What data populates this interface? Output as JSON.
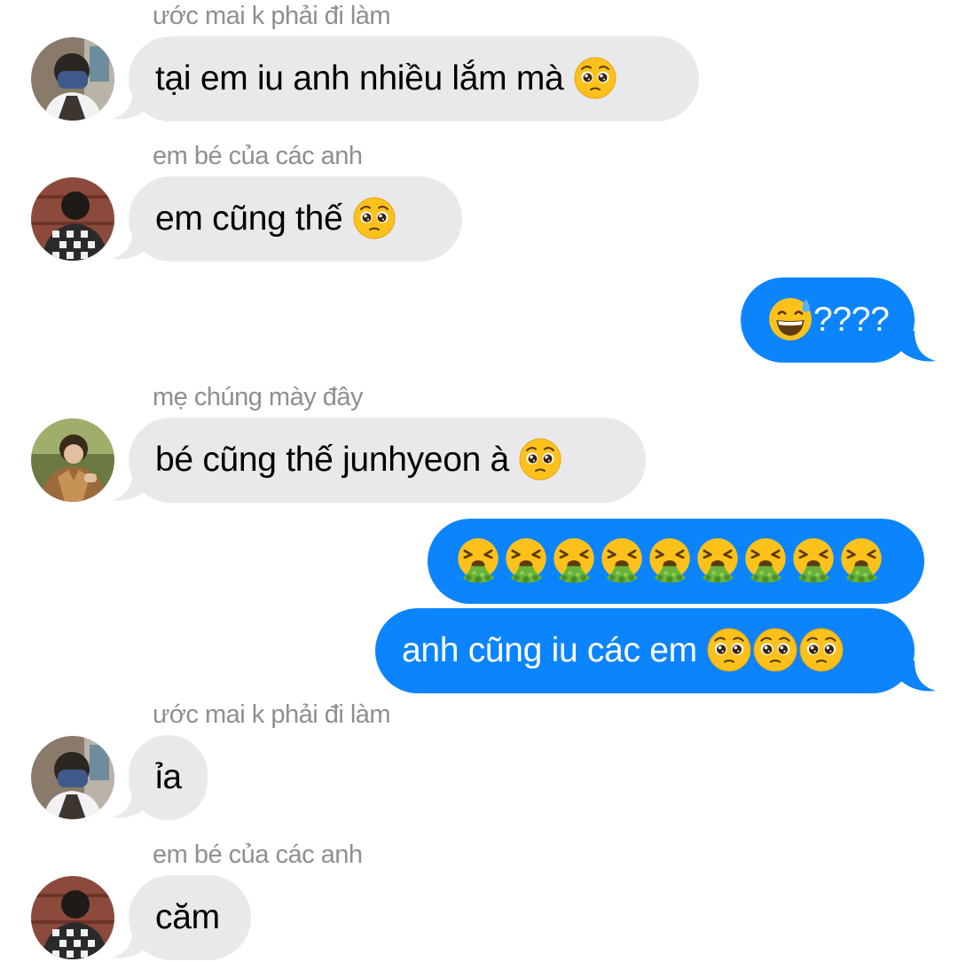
{
  "messages": [
    {
      "sender": "ước mai k phải đi làm",
      "text": "tại em iu anh nhiều lắm mà",
      "emoji": "pleading-face-emoji"
    },
    {
      "sender": "em bé của các anh",
      "text": "em cũng thế",
      "emoji": "pleading-face-emoji"
    },
    {
      "text": "????",
      "emoji": "grinning-sweat-emoji",
      "direction": "outgoing"
    },
    {
      "sender": "mẹ chúng mày đây",
      "text": "bé cũng thế junhyeon à",
      "emoji": "pleading-face-emoji"
    },
    {
      "text": "",
      "emoji": "vomiting-face-emoji",
      "emoji_count": 9,
      "direction": "outgoing"
    },
    {
      "text": "anh cũng iu các em",
      "emoji": "pleading-face-emoji",
      "emoji_count": 3,
      "direction": "outgoing"
    },
    {
      "sender": "ước mai k phải đi làm",
      "text": "ỉa"
    },
    {
      "sender": "em bé của các anh",
      "text": "căm"
    }
  ],
  "colors": {
    "incoming_bubble": "#e9e9eb",
    "outgoing_bubble": "#0b84fe",
    "sender_name": "#8e8e93"
  }
}
